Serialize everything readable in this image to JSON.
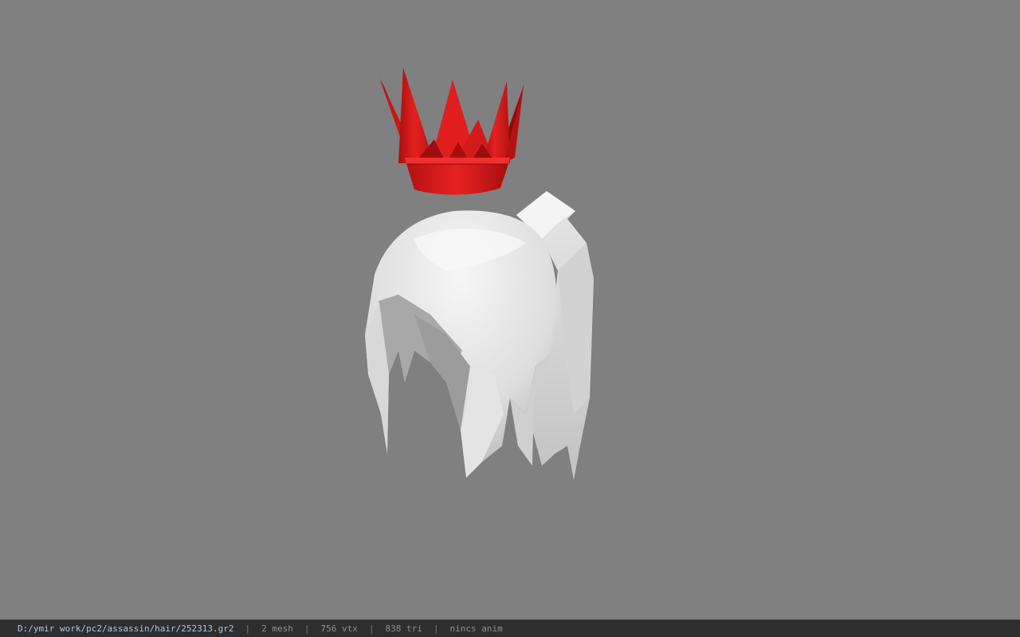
{
  "viewer": {
    "background_color": "#808080",
    "model": {
      "accessory_icon": "crown-icon",
      "accessory_color": "#d41818",
      "hair_icon": "hair-mesh-icon",
      "hair_color": "#e8e8e8"
    }
  },
  "status": {
    "file_path": "D:/ymir work/pc2/assassin/hair/252313.gr2",
    "mesh_count": "2 mesh",
    "vertex_count": "756 vtx",
    "triangle_count": "838 tri",
    "animation": "nincs anim",
    "separator": "|"
  }
}
